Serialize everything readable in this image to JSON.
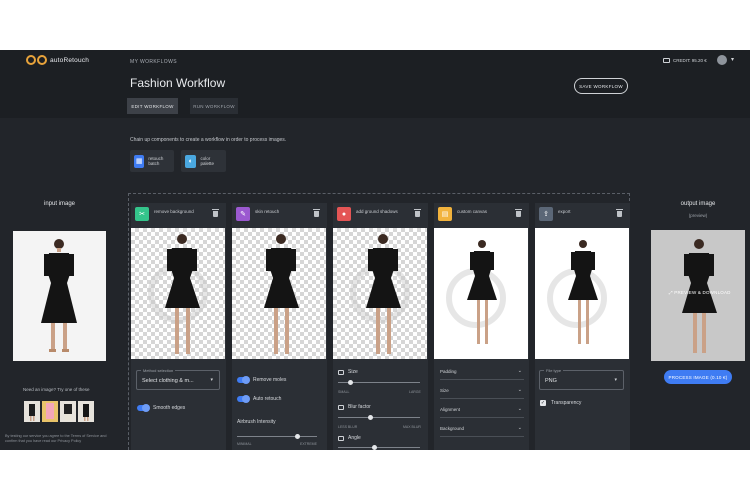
{
  "app": {
    "logo_text": "autoRetouch",
    "breadcrumb": "MY WORKFLOWS",
    "title": "Fashion Workflow",
    "save_button": "SAVE WORKFLOW",
    "credits": "CREDIT: 95.20 €",
    "tabs": [
      "EDIT WORKFLOW",
      "RUN WORKFLOW"
    ]
  },
  "intro": "Chain up components to create a workflow in order to process images.",
  "quick_components": [
    {
      "label": "retouch batch",
      "icon": "grid-icon",
      "color": "#3f7cf3"
    },
    {
      "label": "color palette",
      "icon": "palette-icon",
      "color": "#4aa8e0"
    }
  ],
  "input": {
    "label": "input image",
    "samples_label": "Need an image? Try one of these",
    "terms": "By testing our service you agree to the Terms of Service and confirm that you have read our Privacy Policy"
  },
  "output": {
    "label": "output image",
    "sublabel": "(preview)",
    "overlay": "PREVIEW & DOWNLOAD",
    "process_button": "PROCESS IMAGE (0.10 €)"
  },
  "components": [
    {
      "title": "remove background",
      "icon": "scissors-icon",
      "color": "#34c48b",
      "bg": "checker",
      "controls": {
        "select_caption": "Method selection",
        "select_value": "Select clothing & m...",
        "toggle_label": "Smooth edges"
      }
    },
    {
      "title": "skin retouch",
      "icon": "wand-icon",
      "color": "#9b59d0",
      "bg": "checker",
      "controls": {
        "toggle1": "Remove moles",
        "toggle2": "Auto retouch",
        "slider_label": "Airbrush Intensity",
        "slider_value": 0.75,
        "min": "MINIMAL",
        "max": "EXTREME"
      }
    },
    {
      "title": "add ground shadows",
      "icon": "shadow-icon",
      "color": "#e45555",
      "bg": "checker",
      "controls": {
        "size_label": "Size",
        "size_value": 0.15,
        "size_min": "SMALL",
        "size_max": "LARGE",
        "blur_label": "Blur factor",
        "blur_value": 0.4,
        "blur_min": "LESS BLUR",
        "blur_max": "MAX BLUR",
        "angle_label": "Angle",
        "angle_value": 0.45
      }
    },
    {
      "title": "custom canvas",
      "icon": "canvas-icon",
      "color": "#f2b33d",
      "bg": "white",
      "controls": {
        "accordions": [
          "Padding",
          "Size",
          "Alignment",
          "Background"
        ]
      }
    },
    {
      "title": "export",
      "icon": "export-icon",
      "color": "#5b6777",
      "bg": "white",
      "controls": {
        "select_caption": "File type",
        "select_value": "PNG",
        "checkbox_label": "Transparency",
        "checkbox_checked": true
      }
    }
  ]
}
